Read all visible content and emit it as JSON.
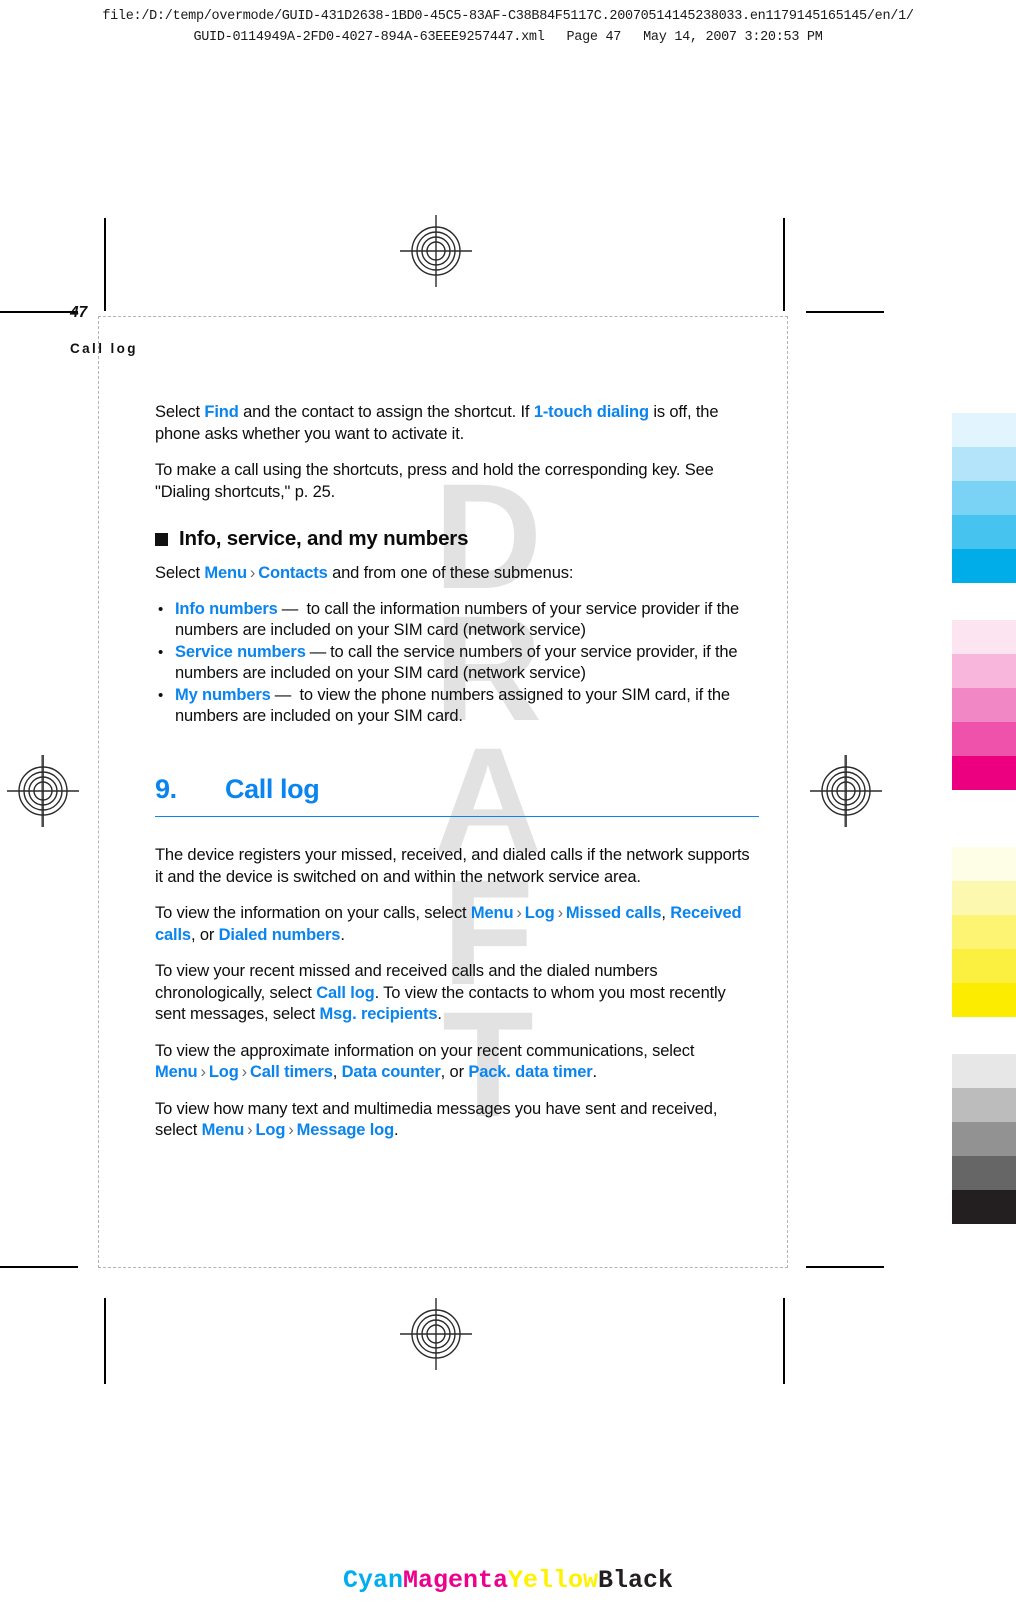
{
  "proof": {
    "filepath_line1": "file:/D:/temp/overmode/GUID-431D2638-1BD0-45C5-83AF-C38B84F5117C.20070514145238033.en1179145165145/en/1/",
    "filepath_line2_file": "GUID-0114949A-2FD0-4027-894A-63EEE9257447.xml",
    "filepath_line2_page": "Page 47",
    "filepath_line2_date": "May 14, 2007 3:20:53 PM",
    "watermark": "DRAFT"
  },
  "page": {
    "running_head": "Call log",
    "page_number": "47"
  },
  "content": {
    "para_shortcut": {
      "t1": "Select ",
      "k1": "Find",
      "t2": " and the contact to assign the shortcut. If ",
      "k2": "1-touch dialing",
      "t3": " is off, the phone asks whether you want to activate it."
    },
    "para_makecall": "To make a call using the shortcuts, press and hold the corresponding key. See \"Dialing shortcuts,\" p. 25.",
    "section_heading": "Info, service, and my numbers",
    "para_select_submenus": {
      "t1": "Select ",
      "k1": "Menu",
      "a1": "›",
      "k2": "Contacts",
      "t2": " and from one of these submenus:"
    },
    "bullets": [
      {
        "term": "Info numbers",
        "dash": "—",
        "text": " to call the information numbers of your service provider if the numbers are included on your SIM card (network service)"
      },
      {
        "term": "Service numbers",
        "dash": "—",
        "text": "to call the service numbers of your service provider, if the numbers are included on your SIM card (network service)"
      },
      {
        "term": "My numbers",
        "dash": "—",
        "text": " to view the phone numbers assigned to your SIM card, if the numbers are included on your SIM card."
      }
    ],
    "chapter": {
      "number": "9.",
      "title": "Call log"
    },
    "para_registers": "The device registers your missed, received, and dialed calls if the network supports it and the device is switched on and within the network service area.",
    "para_view_info": {
      "t1": "To view the information on your calls, select ",
      "k1": "Menu",
      "a1": "›",
      "k2": "Log",
      "a2": "›",
      "k3": "Missed calls",
      "t2": ", ",
      "k4": "Received calls",
      "t3": ", or ",
      "k5": "Dialed numbers",
      "t4": "."
    },
    "para_recent": {
      "t1": "To view your recent missed and received calls and the dialed numbers chronologically, select ",
      "k1": "Call log",
      "t2": ". To view the contacts to whom you most recently sent messages, select ",
      "k2": "Msg. recipients",
      "t3": "."
    },
    "para_approx": {
      "t1": "To view the approximate information on your recent communications, select ",
      "k1": "Menu",
      "a1": "›",
      "k2": "Log",
      "a2": "›",
      "k3": "Call timers",
      "t2": ", ",
      "k4": "Data counter",
      "t3": ", or ",
      "k5": "Pack. data timer",
      "t4": "."
    },
    "para_messages": {
      "t1": "To view how many text and multimedia messages you have sent and received, select ",
      "k1": "Menu",
      "a1": "›",
      "k2": "Log",
      "a2": "›",
      "k3": "Message log",
      "t2": "."
    }
  },
  "cmyk_bar": [
    {
      "label": "Cyan",
      "color": "#00aeef"
    },
    {
      "label": "Magenta",
      "color": "#ec008c"
    },
    {
      "label": "Yellow",
      "color": "#fff200"
    },
    {
      "label": "Black",
      "color": "#231f20"
    }
  ],
  "swatches": {
    "cyan": [
      "#e2f4fd",
      "#b3e4f9",
      "#7ad3f4",
      "#47c3f0",
      "#00ade9"
    ],
    "magenta": [
      "#fce4f1",
      "#f9b6dc",
      "#f287c6",
      "#ef52ab",
      "#ec0080"
    ],
    "yellow": [
      "#fefde6",
      "#fdf8b0",
      "#fcf472",
      "#fbef40",
      "#fbec00"
    ],
    "gray": [
      "#e7e7e7",
      "#bcbcbc",
      "#929292",
      "#666666",
      "#231f20"
    ]
  },
  "colors": {
    "accent_blue": "#0a84ee",
    "body_text": "#0d0d0d"
  }
}
